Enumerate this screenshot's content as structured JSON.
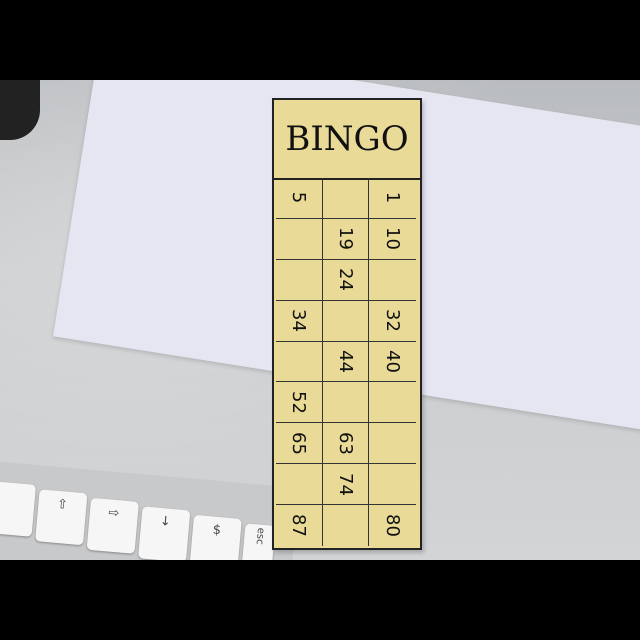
{
  "card": {
    "title": "BINGO",
    "rows": [
      [
        "5",
        "",
        "1"
      ],
      [
        "",
        "19",
        "10"
      ],
      [
        "",
        "24",
        ""
      ],
      [
        "34",
        "",
        "32"
      ],
      [
        "",
        "44",
        "40"
      ],
      [
        "52",
        "",
        ""
      ],
      [
        "65",
        "63",
        ""
      ],
      [
        "",
        "74",
        ""
      ],
      [
        "87",
        "",
        "80"
      ]
    ]
  },
  "keyboard": {
    "keys": [
      "⇧",
      "⇨",
      "↓",
      "$",
      "esc"
    ]
  }
}
